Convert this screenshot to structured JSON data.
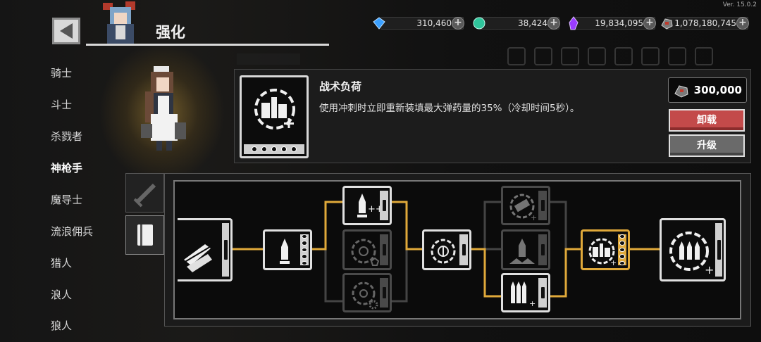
{
  "header": {
    "title": "强化",
    "version": "Ver. 15.0.2"
  },
  "resources": [
    {
      "name": "diamond",
      "value": "310,460",
      "color": "#3aa0ff"
    },
    {
      "name": "gem",
      "value": "38,424",
      "color": "#2fc59b"
    },
    {
      "name": "crystal",
      "value": "19,834,095",
      "color": "#9a3cff"
    },
    {
      "name": "ore",
      "value": "1,078,180,745",
      "color": "#c0392b"
    }
  ],
  "sidebar": {
    "items": [
      {
        "label": "骑士"
      },
      {
        "label": "斗士"
      },
      {
        "label": "杀戮者"
      },
      {
        "label": "神枪手"
      },
      {
        "label": "魔导士"
      },
      {
        "label": "流浪佣兵"
      },
      {
        "label": "猎人"
      },
      {
        "label": "浪人"
      },
      {
        "label": "狼人"
      }
    ],
    "active_index": 3
  },
  "skill": {
    "name": "战术负荷",
    "description": "使用冲刺时立即重新装填最大弹药量的35%（冷却时间5秒）。",
    "cost": "300,000",
    "unload_label": "卸载",
    "upgrade_label": "升级"
  },
  "colors": {
    "accent": "#e0a93a",
    "unload": "#c34a4a",
    "upgrade": "#6a6a6a"
  },
  "tree": {
    "nodes": [
      {
        "id": "root",
        "icon": "bullet-slash-icon",
        "state": "active"
      },
      {
        "id": "t1",
        "icon": "rocket-icon",
        "state": "active"
      },
      {
        "id": "t2a",
        "icon": "rocket-plus-icon",
        "state": "active"
      },
      {
        "id": "t2b",
        "icon": "ring-pentagon-icon",
        "state": "locked"
      },
      {
        "id": "t2c",
        "icon": "ring-gear-icon",
        "state": "locked"
      },
      {
        "id": "t3",
        "icon": "ring-target-icon",
        "state": "active"
      },
      {
        "id": "t4a",
        "icon": "ring-barrel-icon",
        "state": "locked"
      },
      {
        "id": "t4b",
        "icon": "rocket-launch-icon",
        "state": "locked"
      },
      {
        "id": "t4c",
        "icon": "bullets-plus-icon",
        "state": "active"
      },
      {
        "id": "t5",
        "icon": "tactical-load-icon",
        "state": "selected"
      },
      {
        "id": "t6",
        "icon": "ring-bullets-icon",
        "state": "active"
      }
    ]
  }
}
